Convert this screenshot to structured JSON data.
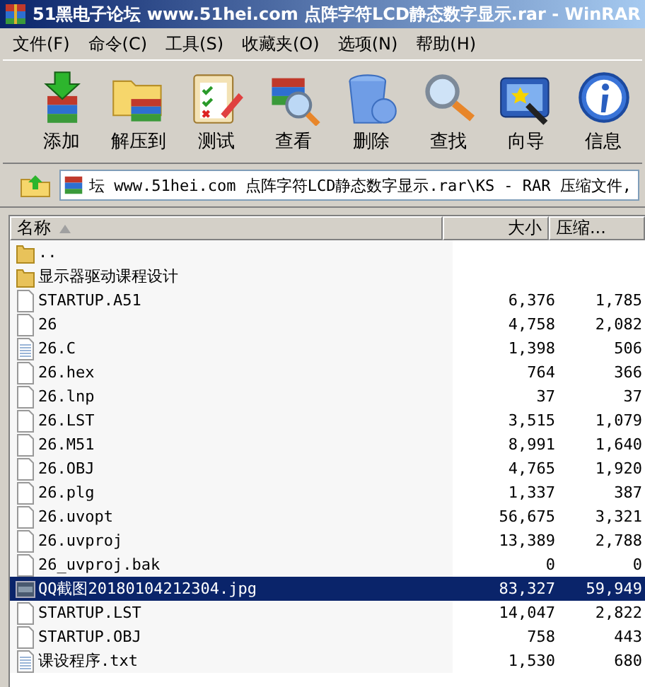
{
  "window": {
    "title": "51黑电子论坛 www.51hei.com 点阵字符LCD静态数字显示.rar - WinRAR"
  },
  "menu": [
    "文件(F)",
    "命令(C)",
    "工具(S)",
    "收藏夹(O)",
    "选项(N)",
    "帮助(H)"
  ],
  "toolbar": [
    {
      "label": "添加",
      "kind": "add"
    },
    {
      "label": "解压到",
      "kind": "extract"
    },
    {
      "label": "测试",
      "kind": "test"
    },
    {
      "label": "查看",
      "kind": "view"
    },
    {
      "label": "删除",
      "kind": "delete"
    },
    {
      "label": "查找",
      "kind": "find"
    },
    {
      "label": "向导",
      "kind": "wizard"
    },
    {
      "label": "信息",
      "kind": "info"
    }
  ],
  "address": {
    "path": "坛 www.51hei.com 点阵字符LCD静态数字显示.rar\\KS - RAR 压缩文件,"
  },
  "table": {
    "columns": [
      {
        "label": "名称",
        "sorted": true
      },
      {
        "label": "大小",
        "sorted": false
      },
      {
        "label": "压缩...",
        "sorted": false
      }
    ],
    "rows": [
      {
        "name": "..",
        "size": "",
        "packed": "",
        "kind": "folder",
        "selected": false
      },
      {
        "name": "显示器驱动课程设计",
        "size": "",
        "packed": "",
        "kind": "folder",
        "selected": false
      },
      {
        "name": "STARTUP.A51",
        "size": "6,376",
        "packed": "1,785",
        "kind": "file",
        "selected": false
      },
      {
        "name": "26",
        "size": "4,758",
        "packed": "2,082",
        "kind": "file",
        "selected": false
      },
      {
        "name": "26.C",
        "size": "1,398",
        "packed": "506",
        "kind": "text",
        "selected": false
      },
      {
        "name": "26.hex",
        "size": "764",
        "packed": "366",
        "kind": "file",
        "selected": false
      },
      {
        "name": "26.lnp",
        "size": "37",
        "packed": "37",
        "kind": "file",
        "selected": false
      },
      {
        "name": "26.LST",
        "size": "3,515",
        "packed": "1,079",
        "kind": "file",
        "selected": false
      },
      {
        "name": "26.M51",
        "size": "8,991",
        "packed": "1,640",
        "kind": "file",
        "selected": false
      },
      {
        "name": "26.OBJ",
        "size": "4,765",
        "packed": "1,920",
        "kind": "file",
        "selected": false
      },
      {
        "name": "26.plg",
        "size": "1,337",
        "packed": "387",
        "kind": "file",
        "selected": false
      },
      {
        "name": "26.uvopt",
        "size": "56,675",
        "packed": "3,321",
        "kind": "file",
        "selected": false
      },
      {
        "name": "26.uvproj",
        "size": "13,389",
        "packed": "2,788",
        "kind": "file",
        "selected": false
      },
      {
        "name": "26_uvproj.bak",
        "size": "0",
        "packed": "0",
        "kind": "file",
        "selected": false
      },
      {
        "name": "QQ截图20180104212304.jpg",
        "size": "83,327",
        "packed": "59,949",
        "kind": "image",
        "selected": true
      },
      {
        "name": "STARTUP.LST",
        "size": "14,047",
        "packed": "2,822",
        "kind": "file",
        "selected": false
      },
      {
        "name": "STARTUP.OBJ",
        "size": "758",
        "packed": "443",
        "kind": "file",
        "selected": false
      },
      {
        "name": "课设程序.txt",
        "size": "1,530",
        "packed": "680",
        "kind": "text",
        "selected": false
      }
    ]
  }
}
